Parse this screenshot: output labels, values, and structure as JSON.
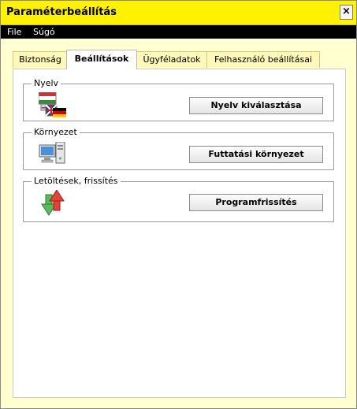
{
  "window": {
    "title": "Paraméterbeállítás",
    "close_label": "×"
  },
  "menu": {
    "items": [
      "File",
      "Súgó"
    ]
  },
  "tabs": [
    {
      "label": "Biztonság",
      "active": false
    },
    {
      "label": "Beállítások",
      "active": true
    },
    {
      "label": "Ügyféladatok",
      "active": false
    },
    {
      "label": "Felhasználó beállításai",
      "active": false
    }
  ],
  "groups": {
    "language": {
      "label": "Nyelv",
      "button": "Nyelv kiválasztása",
      "icon": "language-flags-icon"
    },
    "environment": {
      "label": "Környezet",
      "button": "Futtatási környezet",
      "icon": "computer-icon"
    },
    "updates": {
      "label": "Letöltések, frissítés",
      "button": "Programfrissítés",
      "icon": "update-arrows-icon"
    }
  },
  "colors": {
    "titlebar": "#fff200",
    "menubar": "#000000",
    "window_bg": "#ffffd0"
  }
}
